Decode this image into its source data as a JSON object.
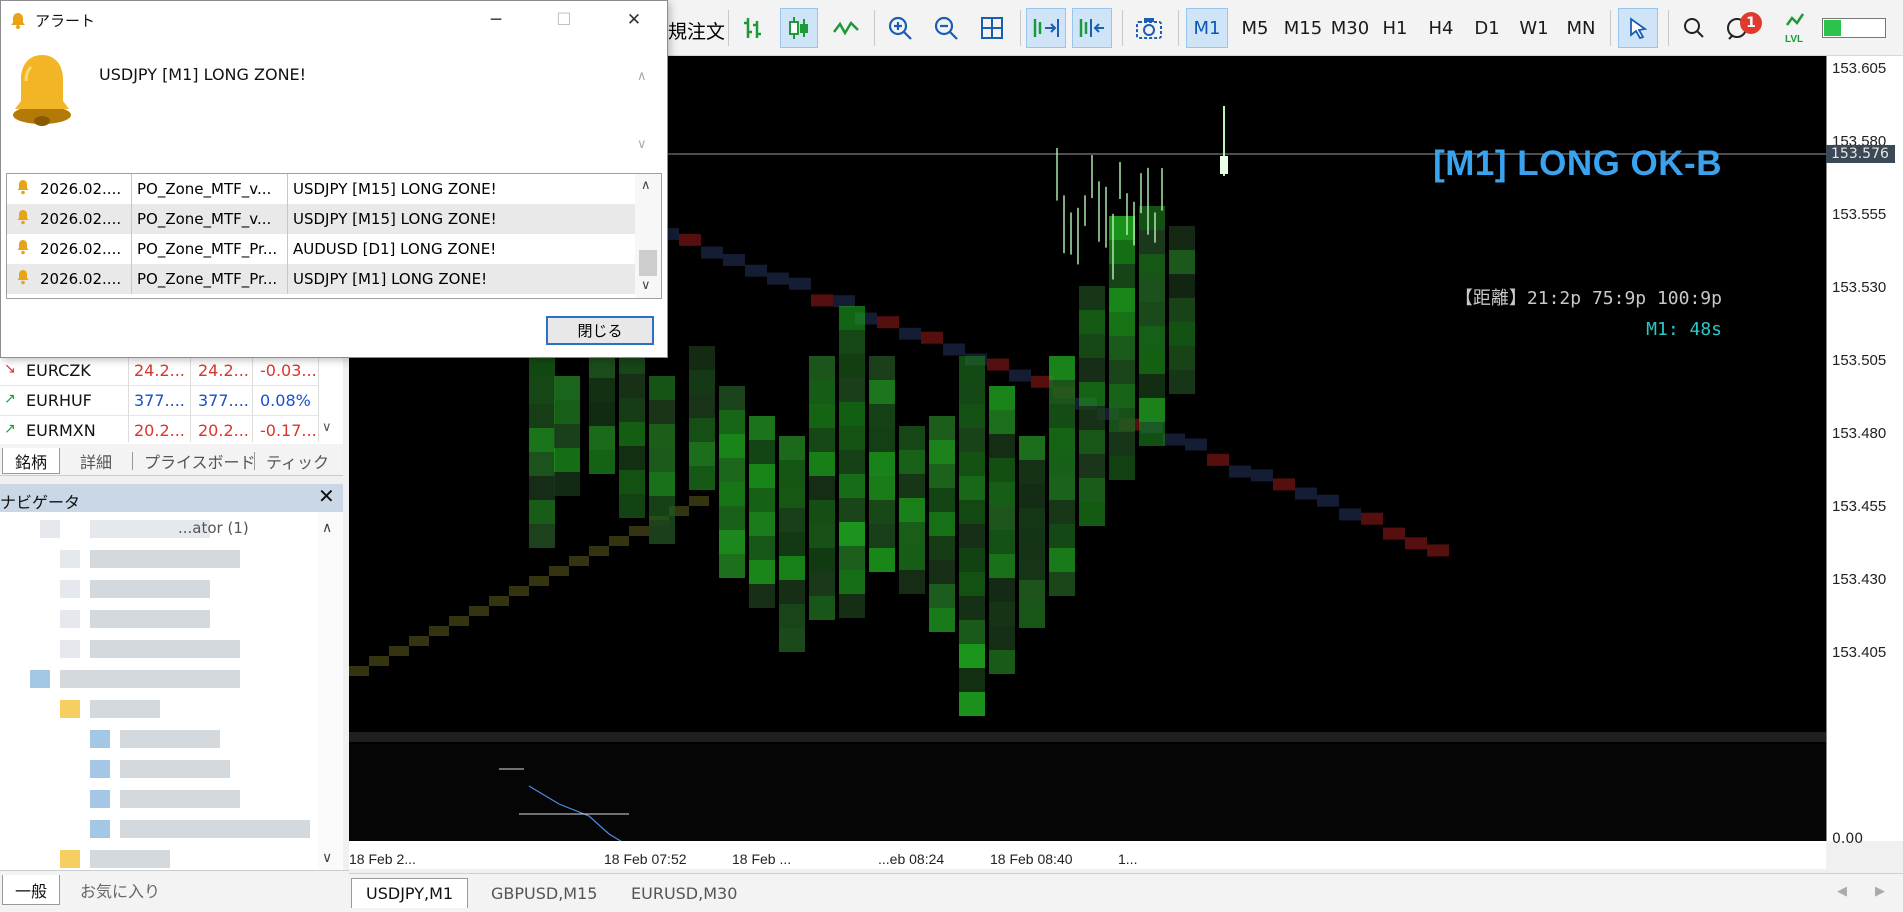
{
  "toolbar": {
    "new_order_label": "規注文",
    "timeframes": [
      "M1",
      "M5",
      "M15",
      "M30",
      "H1",
      "H4",
      "D1",
      "W1",
      "MN"
    ],
    "active_timeframe": "M1",
    "notification_count": "1",
    "lvl_label": "LVL",
    "lvl_fraction": 0.28
  },
  "alert_dialog": {
    "title": "アラート",
    "message": "USDJPY [M1] LONG ZONE!",
    "rows": [
      {
        "date": "2026.02....",
        "name": "PO_Zone_MTF_v...",
        "message": "USDJPY [M15] LONG ZONE!"
      },
      {
        "date": "2026.02....",
        "name": "PO_Zone_MTF_v...",
        "message": "USDJPY [M15] LONG ZONE!"
      },
      {
        "date": "2026.02....",
        "name": "PO_Zone_MTF_Pr...",
        "message": "AUDUSD [D1] LONG ZONE!"
      },
      {
        "date": "2026.02....",
        "name": "PO_Zone_MTF_Pr...",
        "message": "USDJPY [M1] LONG ZONE!"
      }
    ],
    "close_label": "閉じる"
  },
  "market_watch": {
    "rows": [
      {
        "symbol": "EURCZK",
        "bid": "24.2...",
        "ask": "24.2...",
        "change": "-0.03...",
        "direction": "down"
      },
      {
        "symbol": "EURHUF",
        "bid": "377....",
        "ask": "377....",
        "change": "0.08%",
        "direction": "up"
      },
      {
        "symbol": "EURMXN",
        "bid": "20.2...",
        "ask": "20.2...",
        "change": "-0.17...",
        "direction": "up"
      }
    ],
    "tabs": [
      "銘柄",
      "詳細",
      "プライスボード",
      "ティック"
    ],
    "active_tab": "銘柄"
  },
  "navigator": {
    "title": "ナビゲータ",
    "visible_item": "...ator (1)",
    "tabs": [
      "一般",
      "お気に入り"
    ],
    "active_tab": "一般"
  },
  "chart": {
    "signal_title": "[M1] LONG OK-B",
    "distance_text": "【距離】21:2p  75:9p  100:9p",
    "timer_text": "M1: 48s",
    "current_price": "153.576",
    "price_labels": [
      "153.605",
      "153.580",
      "153.555",
      "153.530",
      "153.505",
      "153.480",
      "153.455",
      "153.430",
      "153.405"
    ],
    "indicator_zero": "0.00",
    "time_labels": [
      "18 Feb 2...",
      "18 Feb 07:52",
      "18 Feb ...",
      "...eb 08:24",
      "18 Feb 08:40",
      "1..."
    ],
    "colors": {
      "signal": "#3aa3f0",
      "timer": "#27c8c6",
      "bull": "#2f8f2f",
      "bear": "#7a1616"
    }
  },
  "chart_tabs": [
    "USDJPY,M1",
    "GBPUSD,M15",
    "EURUSD,M30"
  ],
  "active_chart_tab": "USDJPY,M1"
}
